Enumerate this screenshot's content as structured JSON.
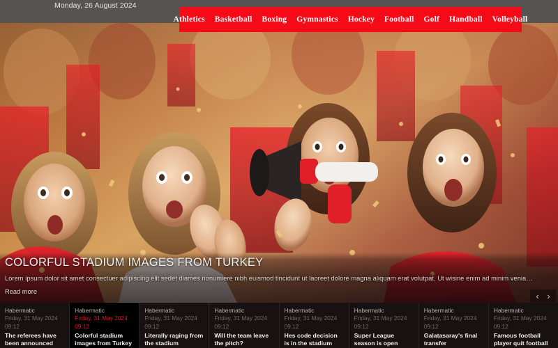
{
  "header": {
    "date": "Monday, 26 August 2024",
    "accent_color": "#f50a18",
    "bar_color": "#565352",
    "nav": [
      {
        "label": "Athletics"
      },
      {
        "label": "Basketball"
      },
      {
        "label": "Boxing"
      },
      {
        "label": "Gymnastics"
      },
      {
        "label": "Hockey"
      },
      {
        "label": "Football"
      },
      {
        "label": "Golf"
      },
      {
        "label": "Handball"
      },
      {
        "label": "Volleyball"
      }
    ]
  },
  "hero": {
    "title": "COLORFUL STADIUM IMAGES FROM TURKEY",
    "description": "Lorem ipsum dolor sit amet consectuer adipiscing elit sedet diames nonumiere nibh euismod tincidunt ut laoreet dolore magna aliquam erat volutpat. Ut wisine enim ad minim veniam, quis nostrud exerci t...",
    "read_more": "Read more",
    "prev_arrow": "‹",
    "next_arrow": "›",
    "image_alt": "Crowd of excited sports fans in red cheering with a megaphone"
  },
  "cards": [
    {
      "source": "Habermatic",
      "date": "Friday, 31 May 2024",
      "time": "09:12",
      "title": "The referees have been announced",
      "active": false
    },
    {
      "source": "Habermatic",
      "date": "Friday, 31 May 2024",
      "time": "09:12",
      "title": "Colorful stadium images from Turkey",
      "active": true
    },
    {
      "source": "Habermatic",
      "date": "Friday, 31 May 2024",
      "time": "09:12",
      "title": "Literally raging from the stadium",
      "active": false
    },
    {
      "source": "Habermatic",
      "date": "Friday, 31 May 2024",
      "time": "09:12",
      "title": "Will the team leave the pitch?",
      "active": false
    },
    {
      "source": "Habermatic",
      "date": "Friday, 31 May 2024",
      "time": "09:12",
      "title": "Hes code decision is in the stadium",
      "active": false
    },
    {
      "source": "Habermatic",
      "date": "Friday, 31 May 2024",
      "time": "09:12",
      "title": "Super League season is open",
      "active": false
    },
    {
      "source": "Habermatic",
      "date": "Friday, 31 May 2024",
      "time": "09:12",
      "title": "Galatasaray's final transfer",
      "active": false
    },
    {
      "source": "Habermatic",
      "date": "Friday, 31 May 2024",
      "time": "09:12",
      "title": "Famous football player quit football",
      "active": false
    }
  ]
}
